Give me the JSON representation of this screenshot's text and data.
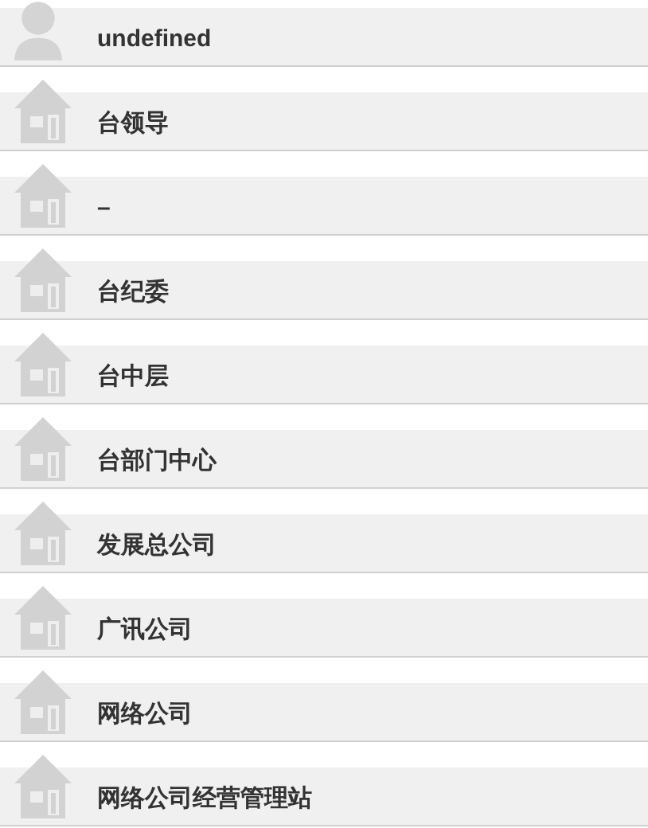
{
  "items": [
    {
      "kind": "person",
      "label": "undefined"
    },
    {
      "kind": "unit",
      "label": "台领导"
    },
    {
      "kind": "unit",
      "label": "–"
    },
    {
      "kind": "unit",
      "label": "台纪委"
    },
    {
      "kind": "unit",
      "label": "台中层"
    },
    {
      "kind": "unit",
      "label": "台部门中心"
    },
    {
      "kind": "unit",
      "label": "发展总公司"
    },
    {
      "kind": "unit",
      "label": "广讯公司"
    },
    {
      "kind": "unit",
      "label": "网络公司"
    },
    {
      "kind": "unit",
      "label": "网络公司经营管理站"
    }
  ]
}
